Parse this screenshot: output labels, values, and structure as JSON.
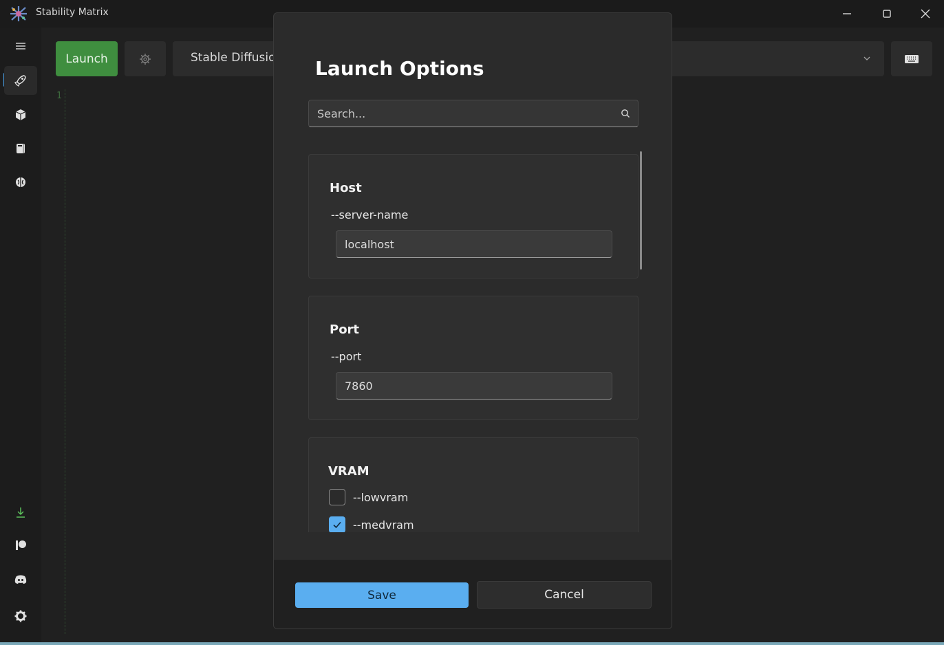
{
  "window": {
    "title": "Stability Matrix"
  },
  "sidebar": {
    "items": [
      {
        "icon": "menu-icon"
      },
      {
        "icon": "rocket-icon",
        "active": true
      },
      {
        "icon": "box-icon"
      },
      {
        "icon": "model-icon"
      },
      {
        "icon": "brain-icon"
      }
    ],
    "bottom_items": [
      {
        "icon": "download-icon"
      },
      {
        "icon": "patreon-icon"
      },
      {
        "icon": "discord-icon"
      },
      {
        "icon": "settings-icon"
      }
    ]
  },
  "toolbar": {
    "launch_label": "Launch",
    "package_label": "Stable Diffusion"
  },
  "console": {
    "line_number": "1"
  },
  "dialog": {
    "title": "Launch Options",
    "search_placeholder": "Search...",
    "cards": [
      {
        "title": "Host",
        "flag": "--server-name",
        "value": "localhost"
      },
      {
        "title": "Port",
        "flag": "--port",
        "value": "7860"
      },
      {
        "title": "VRAM",
        "options": [
          {
            "label": "--lowvram",
            "checked": false
          },
          {
            "label": "--medvram",
            "checked": true
          }
        ]
      }
    ],
    "save_label": "Save",
    "cancel_label": "Cancel"
  },
  "colors": {
    "accent": "#5aaef0",
    "launch_green": "#3f8e3f"
  }
}
